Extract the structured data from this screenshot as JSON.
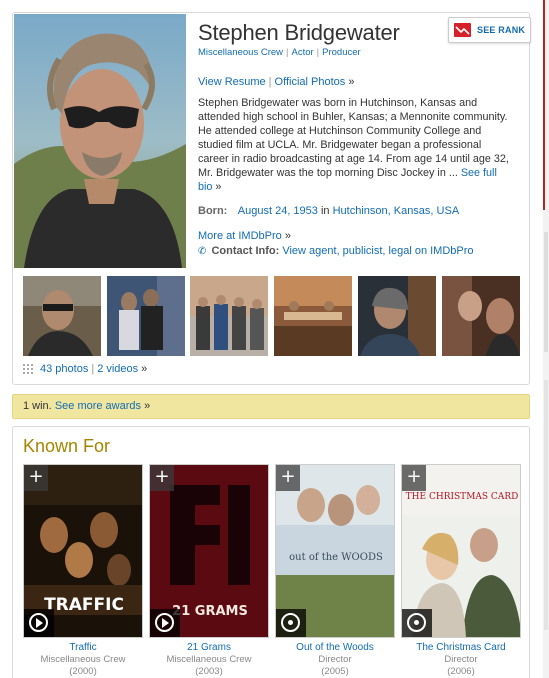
{
  "person": {
    "name": "Stephen Bridgewater",
    "jobs": [
      "Miscellaneous Crew",
      "Actor",
      "Producer"
    ]
  },
  "see_rank": {
    "label": "SEE RANK"
  },
  "links": {
    "view_resume": "View Resume",
    "official_photos": "Official Photos",
    "raquo": "»"
  },
  "bio": {
    "text": "Stephen Bridgewater was born in Hutchinson, Kansas and attended high school in Buhler, Kansas; a Mennonite community. He attended college at Hutchinson Community College and studied film at UCLA. Mr. Bridgewater began a professional career in radio broadcasting at age 14. From age 14 until age 32, Mr. Bridgewater was the top morning Disc Jockey in ...",
    "see_full_bio": "See full bio"
  },
  "born": {
    "label": "Born:",
    "date": "August 24, 1953",
    "in": "in",
    "place": "Hutchinson, Kansas, USA"
  },
  "imdbpro": {
    "more": "More at IMDbPro",
    "contact_label": "Contact Info:",
    "contact_link": "View agent, publicist, legal on IMDbPro"
  },
  "media": {
    "photos": "43 photos",
    "videos": "2 videos"
  },
  "awards": {
    "text": "1 win.",
    "link": "See more awards"
  },
  "known_for": {
    "title": "Known For",
    "films": [
      {
        "title": "Traffic",
        "role": "Miscellaneous Crew",
        "year": "(2000)",
        "poster_word": "TRAFFIC"
      },
      {
        "title": "21 Grams",
        "role": "Miscellaneous Crew",
        "year": "(2003)",
        "poster_word": "21 GRAMS"
      },
      {
        "title": "Out of the Woods",
        "role": "Director",
        "year": "(2005)",
        "poster_word": "out of the WOODS"
      },
      {
        "title": "The Christmas Card",
        "role": "Director",
        "year": "(2006)",
        "poster_word": "THE CHRISTMAS CARD"
      }
    ]
  },
  "colors": {
    "link": "#136cb2",
    "awards_bg": "#f1e6a0",
    "known_title": "#a58500"
  }
}
